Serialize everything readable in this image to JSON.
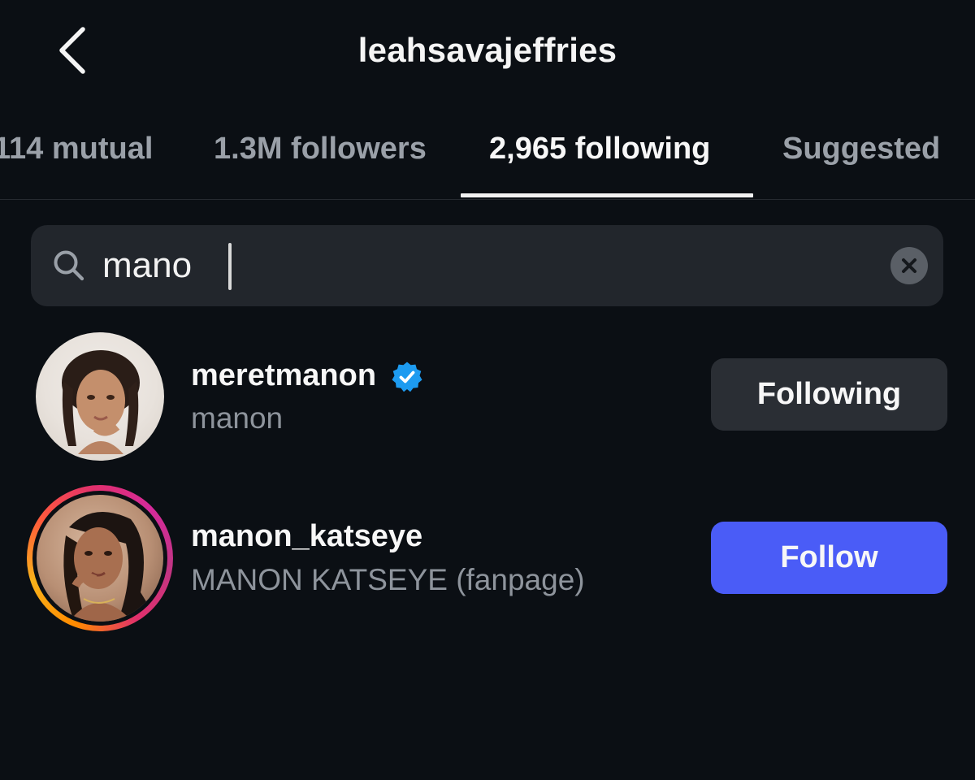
{
  "header": {
    "title": "leahsavajeffries"
  },
  "tabs": [
    {
      "label": "114 mutual",
      "active": false
    },
    {
      "label": "1.3M followers",
      "active": false
    },
    {
      "label": "2,965 following",
      "active": true
    },
    {
      "label": "Suggested",
      "active": false
    }
  ],
  "search": {
    "value": "mano",
    "icon": "search-icon",
    "clear_icon": "close-icon"
  },
  "results": [
    {
      "username": "meretmanon",
      "display_name": "manon",
      "verified": true,
      "has_story": false,
      "button_label": "Following",
      "button_style": "following"
    },
    {
      "username": "manon_katseye",
      "display_name": "MANON KATSEYE (fanpage)",
      "verified": false,
      "has_story": true,
      "button_label": "Follow",
      "button_style": "follow"
    }
  ],
  "colors": {
    "background": "#0b0f14",
    "follow_button": "#4a5cf7",
    "following_button": "#2a2e34",
    "verified_badge": "#1d9bf0",
    "muted_text": "#8e949c"
  }
}
